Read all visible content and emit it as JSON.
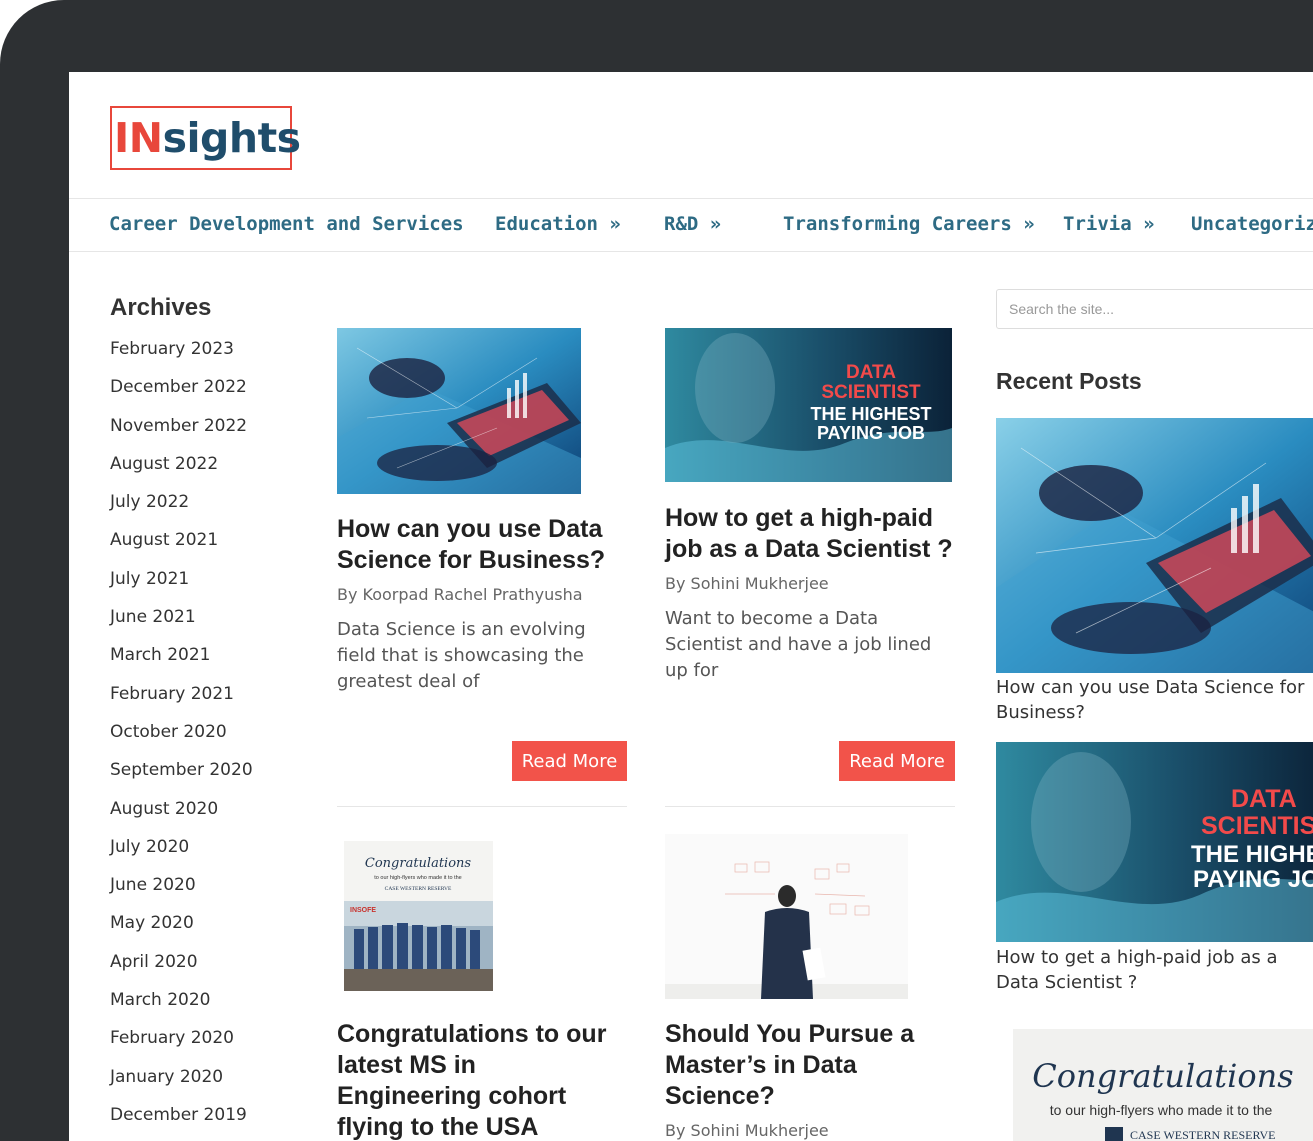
{
  "logo": {
    "in": "IN",
    "rest": "sights"
  },
  "nav": [
    "Career Development and Services",
    "Education »",
    "R&D »",
    "Transforming Careers »",
    "Trivia »",
    "Uncategorize"
  ],
  "archives": {
    "title": "Archives",
    "items": [
      "February 2023",
      "December 2022",
      "November 2022",
      "August 2022",
      "July 2022",
      "August 2021",
      "July 2021",
      "June 2021",
      "March 2021",
      "February 2021",
      "October 2020",
      "September 2020",
      "August 2020",
      "July 2020",
      "June 2020",
      "May 2020",
      "April 2020",
      "March 2020",
      "February 2020",
      "January 2020",
      "December 2019"
    ]
  },
  "posts": [
    {
      "title": "How can you use Data Science for Business?",
      "author": "By Koorpad Rachel Prathyusha",
      "excerpt": "Data Science is an evolving field that is showcasing the greatest deal of",
      "read_more": "Read More"
    },
    {
      "title": "How to get a high-paid job as a Data Scientist ?",
      "author": "By Sohini Mukherjee",
      "excerpt": "Want to become a Data Scientist and have a job lined up for",
      "read_more": "Read More",
      "image_text": [
        "DATA",
        "SCIENTIST",
        "THE HIGHEST",
        "PAYING JOB"
      ]
    },
    {
      "title": "Congratulations to our latest MS in Engineering cohort flying to the USA",
      "image_text": [
        "Congratulations",
        "to our high-flyers who made it to the",
        "CASE WESTERN RESERVE",
        "INSOFE"
      ]
    },
    {
      "title": "Should You Pursue a Master’s in Data Science?",
      "author": "By Sohini Mukherjee"
    }
  ],
  "sidebar": {
    "search_placeholder": "Search the site...",
    "recent_title": "Recent Posts",
    "recent": [
      {
        "caption": "How can you use Data Science for Business?"
      },
      {
        "caption": "How to get a high-paid job as a Data Scientist ?",
        "image_text": [
          "DATA",
          "SCIENTIS",
          "THE HIGHE",
          "PAYING JO"
        ]
      },
      {
        "image_text": [
          "Congratulations",
          "to our high-flyers who made it to the",
          "CASE WESTERN RESERVE"
        ]
      }
    ]
  },
  "colors": {
    "frame": "#2d3033",
    "accent": "#e8473b",
    "nav_link": "#2e6b84",
    "button": "#f2534a"
  }
}
